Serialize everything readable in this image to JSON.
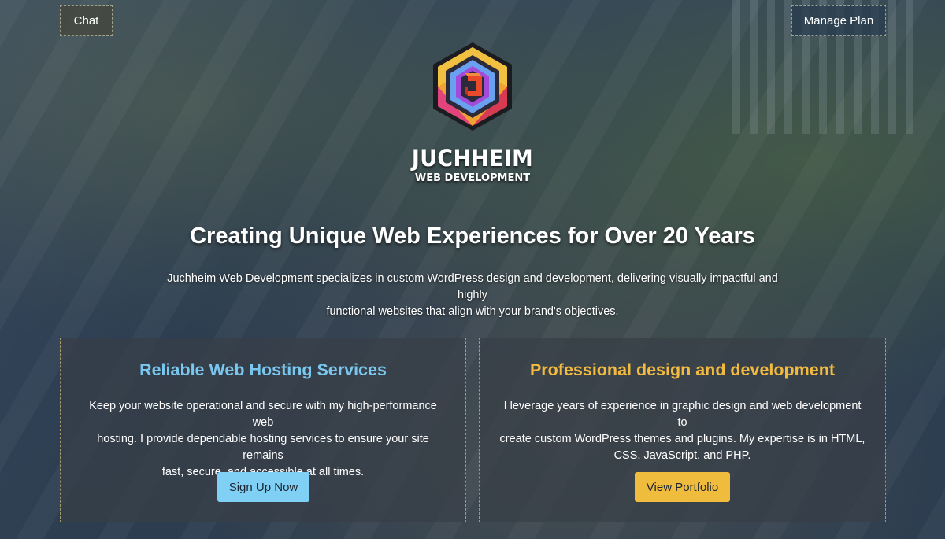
{
  "header": {
    "chat_label": "Chat",
    "manage_plan_label": "Manage Plan"
  },
  "brand": {
    "name": "JUCHHEIM",
    "subtitle": "WEB DEVELOPMENT",
    "logo_icon": "hexagon-j-logo"
  },
  "hero": {
    "headline": "Creating Unique Web Experiences for Over 20 Years",
    "intro_line1": "Juchheim Web Development specializes in custom WordPress design and development, delivering visually impactful and highly",
    "intro_line2": "functional websites that align with your brand's objectives."
  },
  "cards": [
    {
      "title": "Reliable Web Hosting Services",
      "text_line1": "Keep your website operational and secure with my high-performance web",
      "text_line2": "hosting. I provide dependable hosting services to ensure your site remains",
      "text_line3": "fast, secure, and accessible at all times.",
      "button_label": "Sign Up Now"
    },
    {
      "title": "Professional design and development",
      "text_line1": "I leverage years of experience in graphic design and web development to",
      "text_line2": "create custom WordPress themes and plugins. My expertise is in HTML,",
      "text_line3": "CSS, JavaScript, and PHP.",
      "button_label": "View Portfolio"
    }
  ],
  "colors": {
    "hosting_accent": "#79c7ee",
    "design_accent": "#f2bb3f",
    "signup_button": "#7fd0f4",
    "portfolio_button": "#f0bc3e"
  }
}
